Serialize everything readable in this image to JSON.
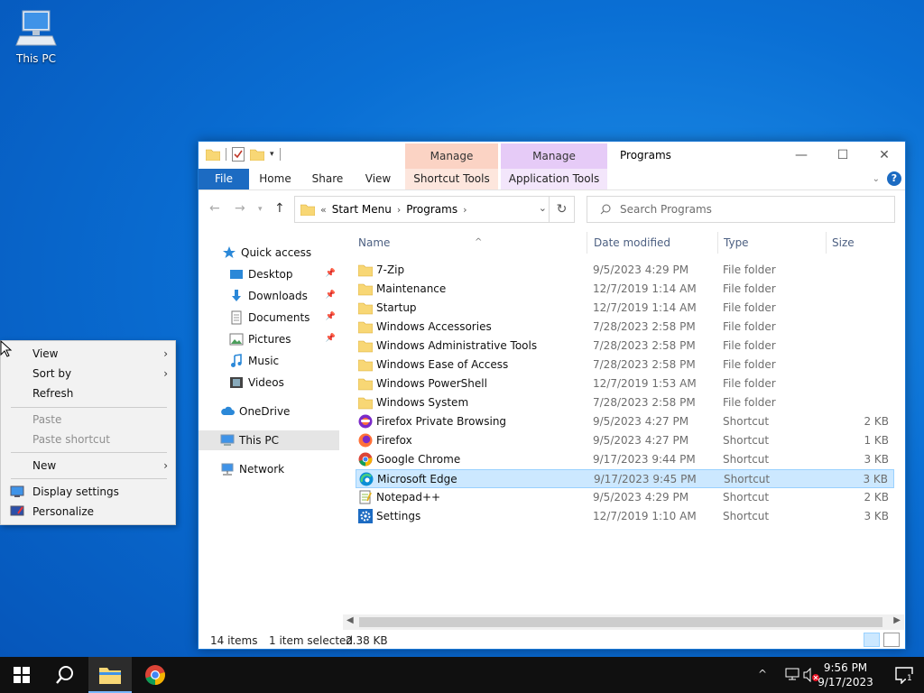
{
  "desktop": {
    "this_pc_label": "This PC"
  },
  "window": {
    "title": "Programs",
    "context_tabs": [
      {
        "header": "Manage",
        "tab": "Shortcut Tools",
        "color": "#fbd3c4"
      },
      {
        "header": "Manage",
        "tab": "Application Tools",
        "color": "#e6cbf7"
      }
    ],
    "ribbon_tabs": [
      "File",
      "Home",
      "Share",
      "View"
    ],
    "caption": {
      "minimize": "—",
      "maximize": "☐",
      "close": "✕"
    },
    "help": "?"
  },
  "address": {
    "prefix": "«",
    "crumbs": [
      "Start Menu",
      "Programs"
    ],
    "separator": "›"
  },
  "search": {
    "placeholder": "Search Programs"
  },
  "nav": {
    "quick_access": "Quick access",
    "items": [
      {
        "label": "Desktop",
        "pinned": true
      },
      {
        "label": "Downloads",
        "pinned": true
      },
      {
        "label": "Documents",
        "pinned": true
      },
      {
        "label": "Pictures",
        "pinned": true
      },
      {
        "label": "Music",
        "pinned": false
      },
      {
        "label": "Videos",
        "pinned": false
      }
    ],
    "onedrive": "OneDrive",
    "this_pc": "This PC",
    "network": "Network"
  },
  "columns": {
    "name": "Name",
    "date": "Date modified",
    "type": "Type",
    "size": "Size"
  },
  "files": [
    {
      "name": "7-Zip",
      "date": "9/5/2023 4:29 PM",
      "type": "File folder",
      "size": "",
      "icon": "folder-icon"
    },
    {
      "name": "Maintenance",
      "date": "12/7/2019 1:14 AM",
      "type": "File folder",
      "size": "",
      "icon": "folder-icon"
    },
    {
      "name": "Startup",
      "date": "12/7/2019 1:14 AM",
      "type": "File folder",
      "size": "",
      "icon": "folder-icon"
    },
    {
      "name": "Windows Accessories",
      "date": "7/28/2023 2:58 PM",
      "type": "File folder",
      "size": "",
      "icon": "folder-icon"
    },
    {
      "name": "Windows Administrative Tools",
      "date": "7/28/2023 2:58 PM",
      "type": "File folder",
      "size": "",
      "icon": "folder-icon"
    },
    {
      "name": "Windows Ease of Access",
      "date": "7/28/2023 2:58 PM",
      "type": "File folder",
      "size": "",
      "icon": "folder-icon"
    },
    {
      "name": "Windows PowerShell",
      "date": "12/7/2019 1:53 AM",
      "type": "File folder",
      "size": "",
      "icon": "folder-icon"
    },
    {
      "name": "Windows System",
      "date": "7/28/2023 2:58 PM",
      "type": "File folder",
      "size": "",
      "icon": "folder-icon"
    },
    {
      "name": "Firefox Private Browsing",
      "date": "9/5/2023 4:27 PM",
      "type": "Shortcut",
      "size": "2 KB",
      "icon": "firefox-private-icon"
    },
    {
      "name": "Firefox",
      "date": "9/5/2023 4:27 PM",
      "type": "Shortcut",
      "size": "1 KB",
      "icon": "firefox-icon"
    },
    {
      "name": "Google Chrome",
      "date": "9/17/2023 9:44 PM",
      "type": "Shortcut",
      "size": "3 KB",
      "icon": "chrome-icon"
    },
    {
      "name": "Microsoft Edge",
      "date": "9/17/2023 9:45 PM",
      "type": "Shortcut",
      "size": "3 KB",
      "icon": "edge-icon",
      "selected": true
    },
    {
      "name": "Notepad++",
      "date": "9/5/2023 4:29 PM",
      "type": "Shortcut",
      "size": "2 KB",
      "icon": "notepadpp-icon"
    },
    {
      "name": "Settings",
      "date": "12/7/2019 1:10 AM",
      "type": "Shortcut",
      "size": "3 KB",
      "icon": "settings-icon"
    }
  ],
  "status": {
    "items": "14 items",
    "selected": "1 item selected",
    "size": "2.38 KB"
  },
  "context_menu": {
    "view": "View",
    "sort_by": "Sort by",
    "refresh": "Refresh",
    "paste": "Paste",
    "paste_shortcut": "Paste shortcut",
    "new": "New",
    "display_settings": "Display settings",
    "personalize": "Personalize",
    "arrow": "›"
  },
  "taskbar": {
    "time": "9:56 PM",
    "date": "9/17/2023",
    "notifications": "1",
    "tray_chevron": "^"
  },
  "colors": {
    "accent": "#1c6bc2",
    "selection": "#cce8ff",
    "folder": "#f8d775"
  }
}
